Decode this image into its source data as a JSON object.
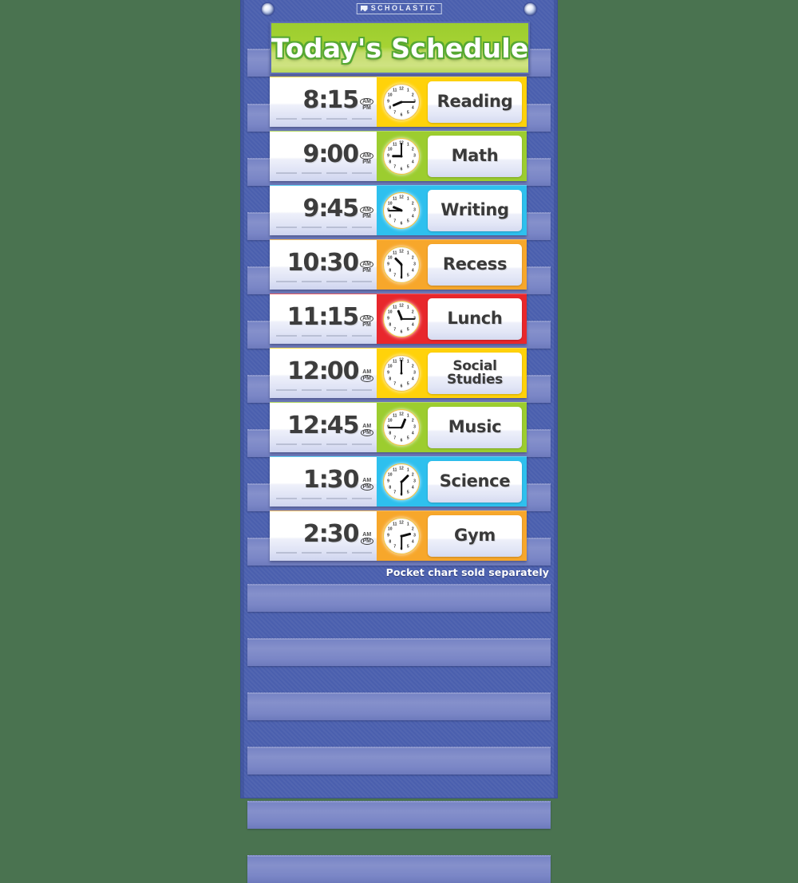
{
  "background_color": "#4a7350",
  "chart": {
    "body_color": "#4a5fae",
    "brand": {
      "name": "SCHOLASTIC",
      "mark": "scholastic-logo-mark"
    },
    "grommets": [
      "grommet-left",
      "grommet-right"
    ],
    "title": "Today's Schedule",
    "title_band_color": "#a6d333",
    "footnote": "Pocket chart sold separately"
  },
  "rows": [
    {
      "time": "8:15",
      "hour": "8",
      "minute": "15",
      "meridiem_selected": "AM",
      "meridiem_options": [
        "AM",
        "PM"
      ],
      "label": "Reading",
      "color": "#ffd20a",
      "clock": {
        "hour_angle": 247,
        "minute_angle": 90
      }
    },
    {
      "time": "9:00",
      "hour": "9",
      "minute": "00",
      "meridiem_selected": "AM",
      "meridiem_options": [
        "AM",
        "PM"
      ],
      "label": "Math",
      "color": "#9ccd2f",
      "clock": {
        "hour_angle": 270,
        "minute_angle": 0
      }
    },
    {
      "time": "9:45",
      "hour": "9",
      "minute": "45",
      "meridiem_selected": "AM",
      "meridiem_options": [
        "AM",
        "PM"
      ],
      "label": "Writing",
      "color": "#2ec0ee",
      "clock": {
        "hour_angle": 292,
        "minute_angle": 270
      }
    },
    {
      "time": "10:30",
      "hour": "10",
      "minute": "30",
      "meridiem_selected": "AM",
      "meridiem_options": [
        "AM",
        "PM"
      ],
      "label": "Recess",
      "color": "#f7a72b",
      "clock": {
        "hour_angle": 315,
        "minute_angle": 180
      }
    },
    {
      "time": "11:15",
      "hour": "11",
      "minute": "15",
      "meridiem_selected": "AM",
      "meridiem_options": [
        "AM",
        "PM"
      ],
      "label": "Lunch",
      "color": "#e8272c",
      "clock": {
        "hour_angle": 337,
        "minute_angle": 90
      }
    },
    {
      "time": "12:00",
      "hour": "12",
      "minute": "00",
      "meridiem_selected": "PM",
      "meridiem_options": [
        "AM",
        "PM"
      ],
      "label": "Social Studies",
      "color": "#ffd20a",
      "clock": {
        "hour_angle": 0,
        "minute_angle": 0
      }
    },
    {
      "time": "12:45",
      "hour": "12",
      "minute": "45",
      "meridiem_selected": "PM",
      "meridiem_options": [
        "AM",
        "PM"
      ],
      "label": "Music",
      "color": "#9ccd2f",
      "clock": {
        "hour_angle": 22,
        "minute_angle": 270
      }
    },
    {
      "time": "1:30",
      "hour": "1",
      "minute": "30",
      "meridiem_selected": "PM",
      "meridiem_options": [
        "AM",
        "PM"
      ],
      "label": "Science",
      "color": "#2ec0ee",
      "clock": {
        "hour_angle": 45,
        "minute_angle": 180
      }
    },
    {
      "time": "2:30",
      "hour": "2",
      "minute": "30",
      "meridiem_selected": "PM",
      "meridiem_options": [
        "AM",
        "PM"
      ],
      "label": "Gym",
      "color": "#f7a72b",
      "clock": {
        "hour_angle": 75,
        "minute_angle": 180
      }
    }
  ],
  "clock_numerals": [
    "12",
    "1",
    "2",
    "3",
    "4",
    "5",
    "6",
    "7",
    "8",
    "9",
    "10",
    "11"
  ],
  "empty_pockets": 6
}
